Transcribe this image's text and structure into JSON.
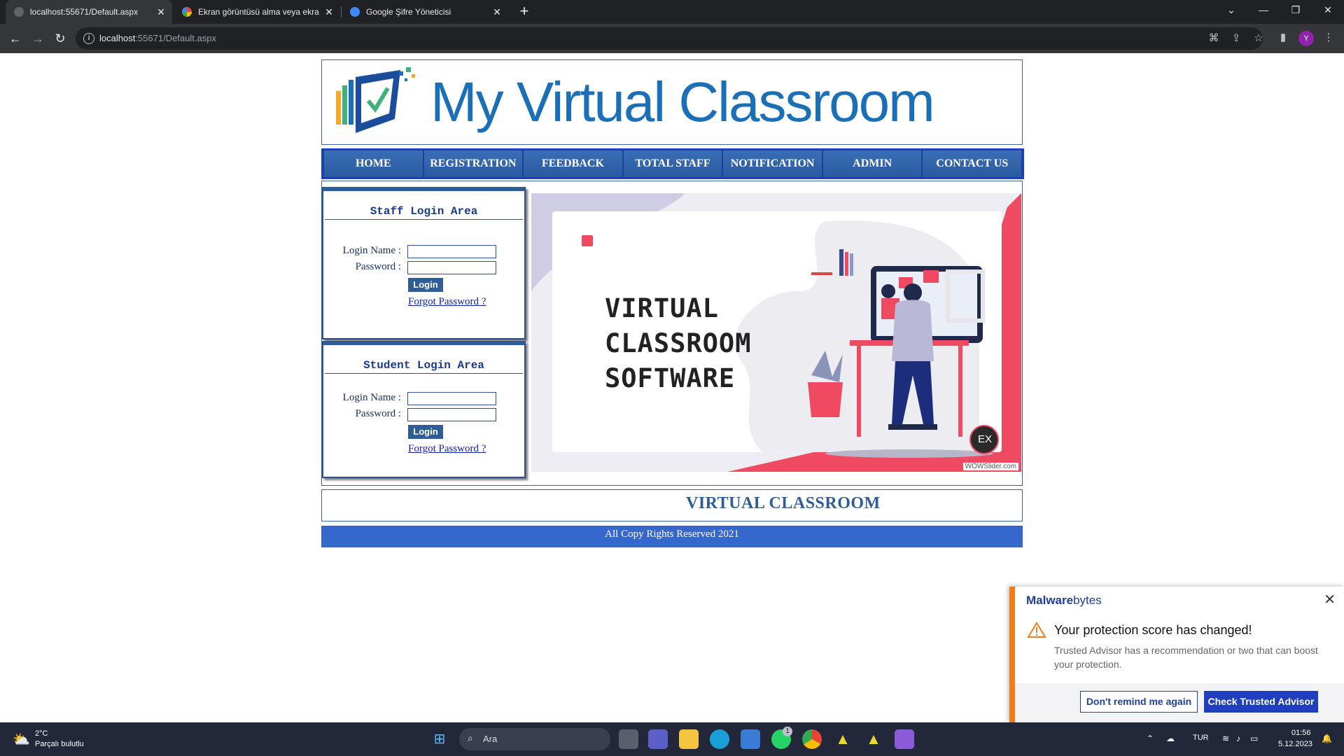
{
  "browser": {
    "tabs": [
      {
        "title": "localhost:55671/Default.aspx",
        "active": true
      },
      {
        "title": "Ekran görüntüsü alma veya ekra",
        "active": false
      },
      {
        "title": "Google Şifre Yöneticisi",
        "active": false
      }
    ],
    "url_host": "localhost",
    "url_rest": ":55671/Default.aspx",
    "avatar_letter": "Y"
  },
  "header": {
    "logo_text": "My Virtual Classroom"
  },
  "menu": {
    "items": [
      "HOME",
      "REGISTRATION",
      "FEEDBACK",
      "TOTAL STAFF",
      "NOTIFICATION",
      "ADMIN",
      "CONTACT US"
    ]
  },
  "staff_login": {
    "title": "Staff Login Area",
    "login_name_label": "Login Name :",
    "password_label": "Password :",
    "login_button": "Login",
    "forgot_link": "Forgot Password ?"
  },
  "student_login": {
    "title": "Student Login Area",
    "login_name_label": "Login Name :",
    "password_label": "Password :",
    "login_button": "Login",
    "forgot_link": "Forgot Password ?"
  },
  "slider": {
    "line1": "VIRTUAL",
    "line2": "CLASSROOM",
    "line3": "SOFTWARE",
    "badge": "EX",
    "credit": "WOWSlider.com"
  },
  "banner": {
    "text": "VIRTUAL CLASSROOM"
  },
  "footer": {
    "text": "All Copy Rights Reserved 2021"
  },
  "toast": {
    "brand_a": "Malware",
    "brand_b": "bytes",
    "title": "Your protection score has changed!",
    "body": "Trusted Advisor has a recommendation or two that can boost your protection.",
    "dismiss_button": "Don't remind me again",
    "action_button": "Check Trusted Advisor"
  },
  "taskbar": {
    "temperature": "2°C",
    "weather": "Parçalı bulutlu",
    "search_placeholder": "Ara",
    "language": "TUR",
    "time": "01:56",
    "date": "5.12.2023",
    "badge_count": "1"
  },
  "colors": {
    "menu_bg": "#2a5a9f",
    "footer_bg": "#3567cc",
    "accent_red": "#f04a63",
    "toast_stripe": "#f07d1a"
  }
}
